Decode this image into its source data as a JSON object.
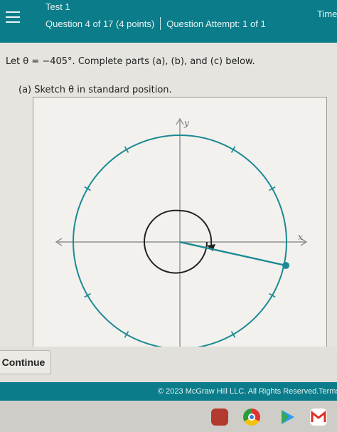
{
  "header": {
    "test_title": "Test 1",
    "question_label": "Question 4 of 17 (4 points)",
    "attempt_label": "Question Attempt: 1 of 1",
    "timer_label": "Time"
  },
  "problem": {
    "prompt": "Let θ = −405°. Complete parts (a), (b), and (c) below.",
    "part_a": "(a) Sketch θ in standard position."
  },
  "graph": {
    "x_label": "x",
    "y_label": "y",
    "angle_degrees": -405
  },
  "footer": {
    "continue_label": "Continue",
    "copyright": "© 2023 McGraw Hill LLC. All Rights Reserved.",
    "terms": "Terms"
  },
  "colors": {
    "header_teal": "#0b7c8a",
    "circle_teal": "#1a8a94"
  },
  "taskbar": {
    "icons": [
      "app-red-icon",
      "chrome-icon",
      "play-store-icon",
      "gmail-icon"
    ]
  }
}
